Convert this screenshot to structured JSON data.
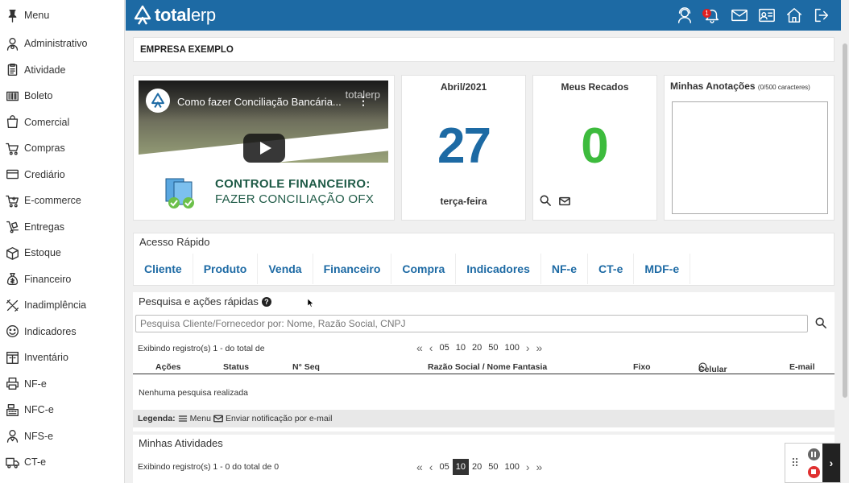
{
  "app": {
    "brand_bold": "total",
    "brand_light": "erp",
    "colors": {
      "primary": "#1d6aa4",
      "accent_green": "#3dbb3d",
      "badge_red": "#e02020"
    }
  },
  "sidebar": {
    "items": [
      {
        "label": "Menu",
        "icon": "pin-icon"
      },
      {
        "label": "Administrativo",
        "icon": "user-admin-icon"
      },
      {
        "label": "Atividade",
        "icon": "clipboard-icon"
      },
      {
        "label": "Boleto",
        "icon": "barcode-icon"
      },
      {
        "label": "Comercial",
        "icon": "shopping-bag-icon"
      },
      {
        "label": "Compras",
        "icon": "cart-icon"
      },
      {
        "label": "Crediário",
        "icon": "credit-card-icon"
      },
      {
        "label": "E-commerce",
        "icon": "ecommerce-cart-icon"
      },
      {
        "label": "Entregas",
        "icon": "dolly-icon"
      },
      {
        "label": "Estoque",
        "icon": "box-icon"
      },
      {
        "label": "Financeiro",
        "icon": "money-bag-icon"
      },
      {
        "label": "Inadimplência",
        "icon": "tools-icon"
      },
      {
        "label": "Indicadores",
        "icon": "smile-icon"
      },
      {
        "label": "Inventário",
        "icon": "inventory-icon"
      },
      {
        "label": "NF-e",
        "icon": "printer-icon"
      },
      {
        "label": "NFC-e",
        "icon": "cash-register-icon"
      },
      {
        "label": "NFS-e",
        "icon": "service-user-icon"
      },
      {
        "label": "CT-e",
        "icon": "truck-icon"
      }
    ]
  },
  "topbar": {
    "notification_count": "1",
    "icons": [
      "support-agent-icon",
      "bell-icon",
      "mail-icon",
      "contact-card-icon",
      "home-icon",
      "logout-icon"
    ]
  },
  "company": {
    "name": "EMPRESA EXEMPLO"
  },
  "video": {
    "title": "Como fazer Conciliação Bancária...",
    "watermark": "totalerp",
    "caption_line1": "CONTROLE FINANCEIRO:",
    "caption_line2": "FAZER CONCILIAÇÃO OFX"
  },
  "calendar": {
    "month": "Abril/2021",
    "day": "27",
    "weekday": "terça-feira"
  },
  "messages": {
    "title": "Meus Recados",
    "count": "0"
  },
  "notes": {
    "title": "Minhas Anotações",
    "counter": "(0/500 caracteres)",
    "value": ""
  },
  "quick_access": {
    "title": "Acesso Rápido",
    "buttons": [
      "Cliente",
      "Produto",
      "Venda",
      "Financeiro",
      "Compra",
      "Indicadores",
      "NF-e",
      "CT-e",
      "MDF-e"
    ]
  },
  "search": {
    "title": "Pesquisa e ações rápidas",
    "placeholder": "Pesquisa Cliente/Fornecedor por: Nome, Razão Social, CNPJ",
    "value": "",
    "info": "Exibindo registro(s) 1 - do total de",
    "page_sizes": [
      "05",
      "10",
      "20",
      "50",
      "100"
    ],
    "columns": [
      "Ações",
      "Status",
      "N° Seq",
      "Razão Social / Nome Fantasia",
      "Fixo",
      "Celular",
      "E-mail"
    ],
    "empty_message": "Nenhuma pesquisa realizada",
    "legend_label": "Legenda:",
    "legend_menu": "Menu",
    "legend_mail": "Enviar notificação por e-mail"
  },
  "activities": {
    "title": "Minhas Atividades",
    "info": "Exibindo registro(s) 1 - 0 do total de 0",
    "page_sizes": [
      "05",
      "10",
      "20",
      "50",
      "100"
    ],
    "active_page_size": "10"
  }
}
